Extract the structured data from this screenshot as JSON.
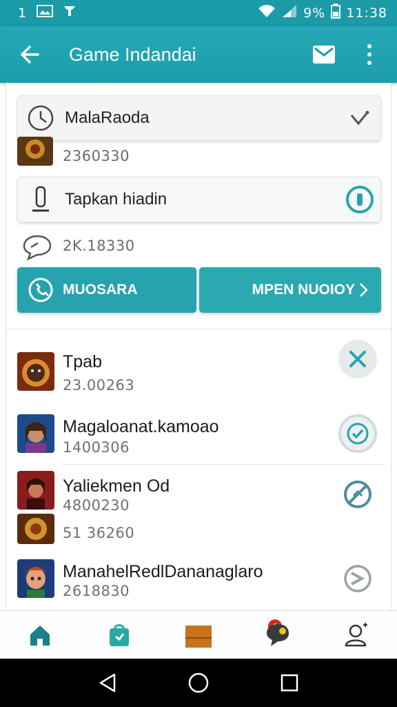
{
  "status_bar": {
    "left_text": "1",
    "battery_text": "9%",
    "time": "11:38"
  },
  "app_bar": {
    "title": "Game Indandai"
  },
  "cards": [
    {
      "label": "MalaRaoda",
      "sub": "2360330"
    },
    {
      "label": "Tapkan hiadin",
      "sub": "2K.18330"
    }
  ],
  "buttons": {
    "left_label": "MUOSARA",
    "right_label": "MPEN NUOIOY"
  },
  "list": [
    {
      "title": "Tpab",
      "sub": "23.00263"
    },
    {
      "title": "Magaloanat.kamoao",
      "sub": "1400306"
    },
    {
      "title": "Yaliekmen Od",
      "sub": "4800230",
      "sub2": "51 36260"
    },
    {
      "title": "ManahelRedlDananaglaro",
      "sub": "2618830"
    }
  ],
  "bottom_nav": {
    "badge_count": "1"
  },
  "colors": {
    "primary": "#1d9dab",
    "accent": "#26a3ae"
  }
}
